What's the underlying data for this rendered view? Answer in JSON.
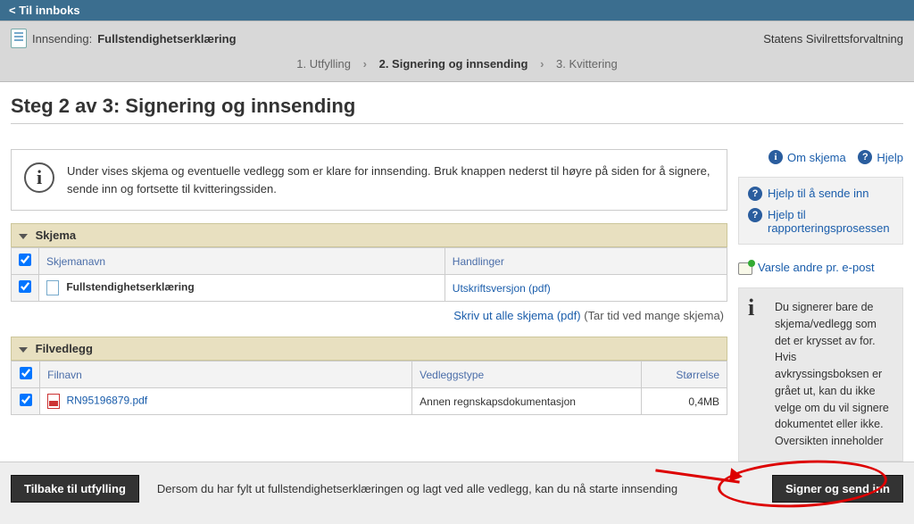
{
  "topbar": {
    "back_label": "< Til innboks"
  },
  "header": {
    "title_label": "Innsending:",
    "title_value": "Fullstendighetserklæring",
    "org_label": "Statens Sivilrettsforvaltning"
  },
  "steps": {
    "s1": "1. Utfylling",
    "s2": "2. Signering og innsending",
    "s3": "3. Kvittering"
  },
  "page": {
    "heading_prefix": "Steg 2 av 3:",
    "heading_bold": "Signering og innsending"
  },
  "infobox": {
    "text": "Under vises skjema og eventuelle vedlegg som er klare for innsending. Bruk knappen nederst til høyre på siden for å signere, sende inn og fortsette til kvitteringssiden."
  },
  "skjema_panel": {
    "title": "Skjema",
    "col_check": "",
    "col_name": "Skjemanavn",
    "col_actions": "Handlinger",
    "row_name": "Fullstendighetserklæring",
    "row_action": "Utskriftsversjon (pdf)",
    "print_all": "Skriv ut alle skjema (pdf)",
    "print_all_note": "(Tar tid ved mange skjema)"
  },
  "filvedlegg_panel": {
    "title": "Filvedlegg",
    "col_name": "Filnavn",
    "col_type": "Vedleggstype",
    "col_size": "Størrelse",
    "row_filename": "RN95196879.pdf",
    "row_type": "Annen regnskapsdokumentasjon",
    "row_size": "0,4MB"
  },
  "right": {
    "om_skjema": "Om skjema",
    "hjelp": "Hjelp",
    "hjelp_sende": "Hjelp til å sende inn",
    "hjelp_rapportering": "Hjelp til rapporteringsprosessen",
    "varsle": "Varsle andre pr. e-post",
    "info_text": "Du signerer bare de skjema/vedlegg som det er krysset av for. Hvis avkryssingsboksen er grået ut, kan du ikke velge om du vil signere dokumentet eller ikke. Oversikten inneholder"
  },
  "footer": {
    "back_btn": "Tilbake til utfylling",
    "text": "Dersom du har fylt ut fullstendighetserklæringen og lagt ved alle vedlegg, kan du nå starte innsending",
    "submit_btn": "Signer og send inn"
  }
}
